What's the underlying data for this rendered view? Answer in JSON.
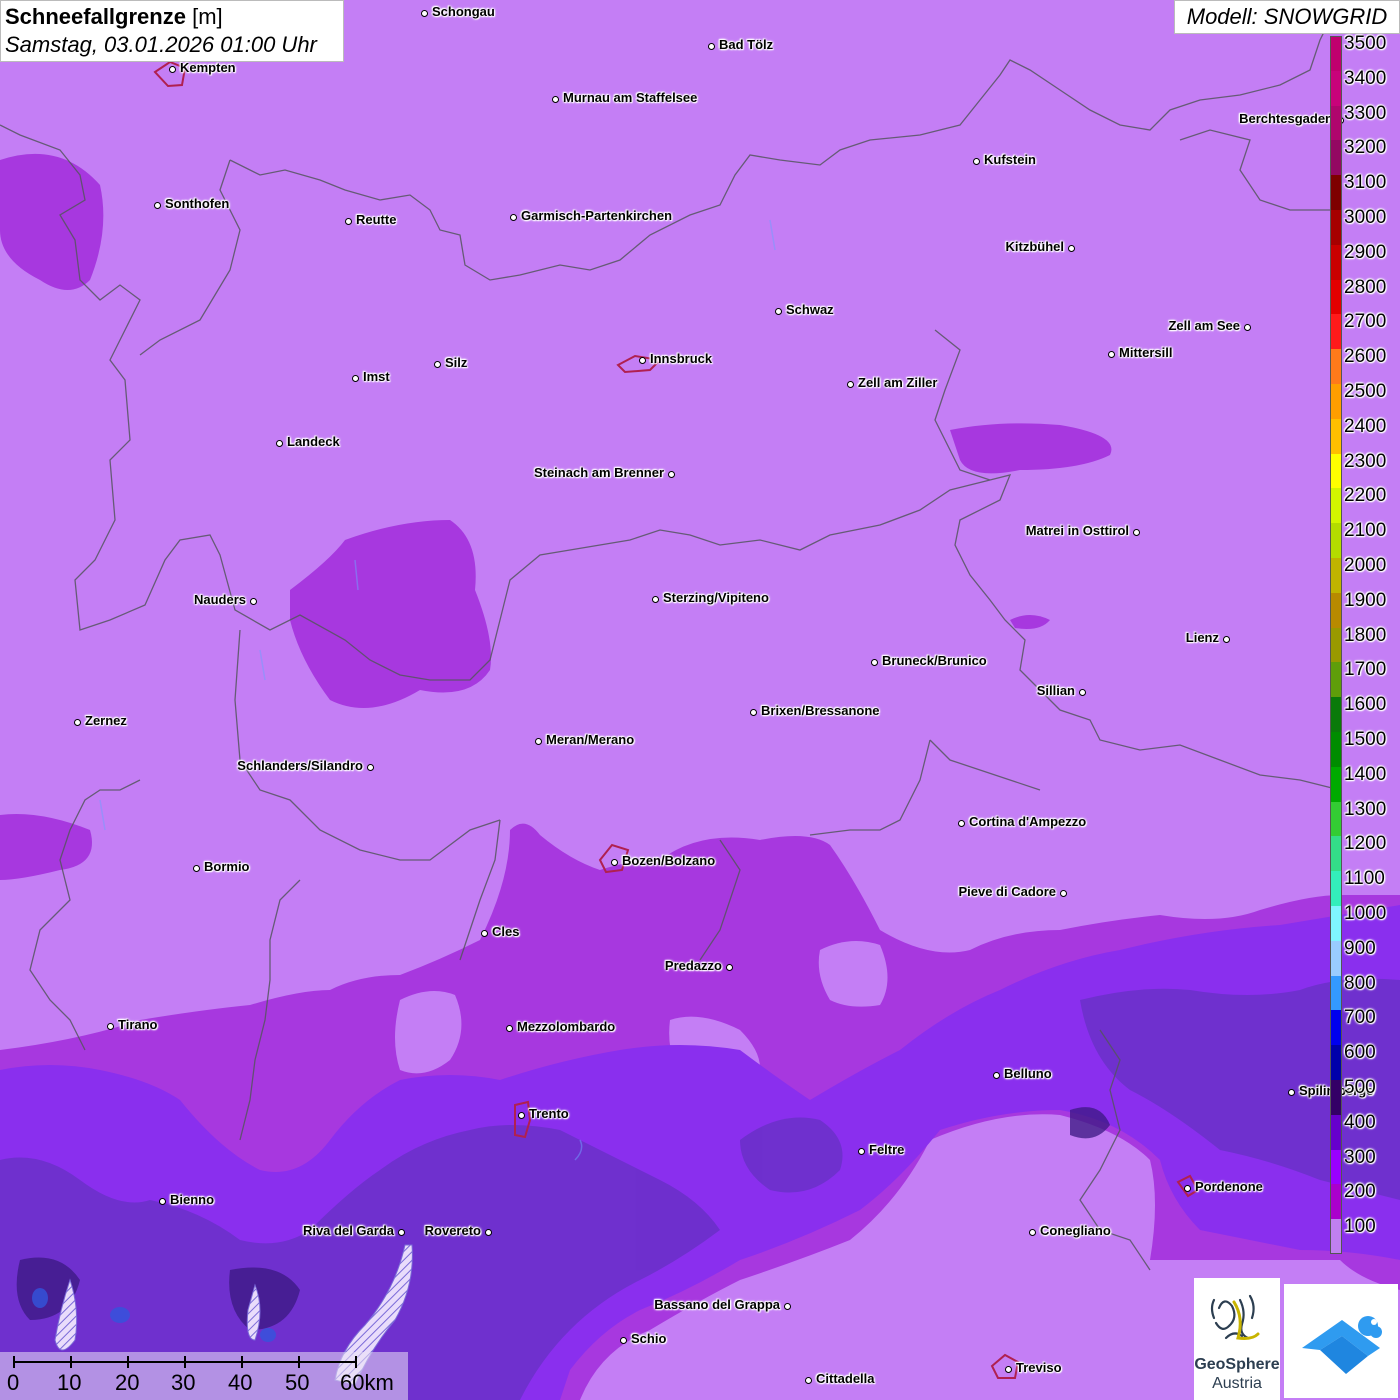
{
  "title": {
    "variable": "Schneefallgrenze",
    "unit": "[m]",
    "datetime": "Samstag, 03.01.2026 01:00 Uhr"
  },
  "model_label": "Modell: SNOWGRID",
  "legend": {
    "colorbar_values": [
      "3500",
      "3400",
      "3300",
      "3200",
      "3100",
      "3000",
      "2900",
      "2800",
      "2700",
      "2600",
      "2500",
      "2400",
      "2300",
      "2200",
      "2100",
      "2000",
      "1900",
      "1800",
      "1700",
      "1600",
      "1500",
      "1400",
      "1300",
      "1200",
      "1100",
      "1000",
      "900",
      "800",
      "700",
      "600",
      "500",
      "400",
      "300",
      "200",
      "100"
    ],
    "colors": [
      "#c0006e",
      "#c8037a",
      "#b0066d",
      "#930862",
      "#7e0000",
      "#a60000",
      "#c90000",
      "#e30000",
      "#ff1a1a",
      "#ff7a1a",
      "#ff9e00",
      "#ffbf00",
      "#ffff00",
      "#d2f500",
      "#b4dc00",
      "#c0b400",
      "#b88a00",
      "#999900",
      "#5f9e0a",
      "#0a7a0a",
      "#008c00",
      "#00aa00",
      "#33cc33",
      "#33dd88",
      "#33eebb",
      "#7ff5ff",
      "#99ccff",
      "#3399ff",
      "#0000ee",
      "#0000aa",
      "#330066",
      "#6600cc",
      "#9900ff",
      "#aa00cc",
      "#c080f0"
    ]
  },
  "cities": [
    {
      "name": "Schongau",
      "label_side": "right"
    },
    {
      "name": "Bad Tölz",
      "label_side": "right"
    },
    {
      "name": "Kempten",
      "label_side": "right"
    },
    {
      "name": "Murnau am Staffelsee",
      "label_side": "right"
    },
    {
      "name": "Berchtesgaden",
      "label_side": "left"
    },
    {
      "name": "Kufstein",
      "label_side": "right"
    },
    {
      "name": "Sonthofen",
      "label_side": "right"
    },
    {
      "name": "Reutte",
      "label_side": "right"
    },
    {
      "name": "Garmisch-Partenkirchen",
      "label_side": "right"
    },
    {
      "name": "Kitzbühel",
      "label_side": "left"
    },
    {
      "name": "Schwaz",
      "label_side": "right"
    },
    {
      "name": "Zell am See",
      "label_side": "left"
    },
    {
      "name": "Innsbruck",
      "label_side": "right"
    },
    {
      "name": "Mittersill",
      "label_side": "right"
    },
    {
      "name": "Imst",
      "label_side": "right"
    },
    {
      "name": "Silz",
      "label_side": "right"
    },
    {
      "name": "Zell am Ziller",
      "label_side": "right"
    },
    {
      "name": "Landeck",
      "label_side": "right"
    },
    {
      "name": "Steinach am Brenner",
      "label_side": "left"
    },
    {
      "name": "Matrei in Osttirol",
      "label_side": "left"
    },
    {
      "name": "Nauders",
      "label_side": "left"
    },
    {
      "name": "Sterzing/Vipiteno",
      "label_side": "right"
    },
    {
      "name": "Lienz",
      "label_side": "left"
    },
    {
      "name": "Bruneck/Brunico",
      "label_side": "right"
    },
    {
      "name": "Sillian",
      "label_side": "left"
    },
    {
      "name": "Brixen/Bressanone",
      "label_side": "right"
    },
    {
      "name": "Zernez",
      "label_side": "right"
    },
    {
      "name": "Meran/Merano",
      "label_side": "right"
    },
    {
      "name": "Schlanders/Silandro",
      "label_side": "left"
    },
    {
      "name": "Cortina d'Ampezzo",
      "label_side": "right"
    },
    {
      "name": "Bozen/Bolzano",
      "label_side": "right"
    },
    {
      "name": "Bormio",
      "label_side": "right"
    },
    {
      "name": "Pieve di Cadore",
      "label_side": "left"
    },
    {
      "name": "Cles",
      "label_side": "right"
    },
    {
      "name": "Predazzo",
      "label_side": "left"
    },
    {
      "name": "Tirano",
      "label_side": "right"
    },
    {
      "name": "Mezzolombardo",
      "label_side": "right"
    },
    {
      "name": "Belluno",
      "label_side": "right"
    },
    {
      "name": "Spilimbergo",
      "label_side": "right"
    },
    {
      "name": "Trento",
      "label_side": "right"
    },
    {
      "name": "Feltre",
      "label_side": "right"
    },
    {
      "name": "Pordenone",
      "label_side": "right"
    },
    {
      "name": "Bienno",
      "label_side": "right"
    },
    {
      "name": "Riva del Garda",
      "label_side": "left"
    },
    {
      "name": "Rovereto",
      "label_side": "left"
    },
    {
      "name": "Conegliano",
      "label_side": "right"
    },
    {
      "name": "Bassano del Grappa",
      "label_side": "left"
    },
    {
      "name": "Schio",
      "label_side": "right"
    },
    {
      "name": "Treviso",
      "label_side": "right"
    },
    {
      "name": "Cittadella",
      "label_side": "right"
    }
  ],
  "scale_bar": {
    "labels": [
      "0",
      "10",
      "20",
      "30",
      "40",
      "50",
      "60km"
    ]
  },
  "logos": {
    "geosphere_line1": "GeoSphere",
    "geosphere_line2": "Austria"
  }
}
